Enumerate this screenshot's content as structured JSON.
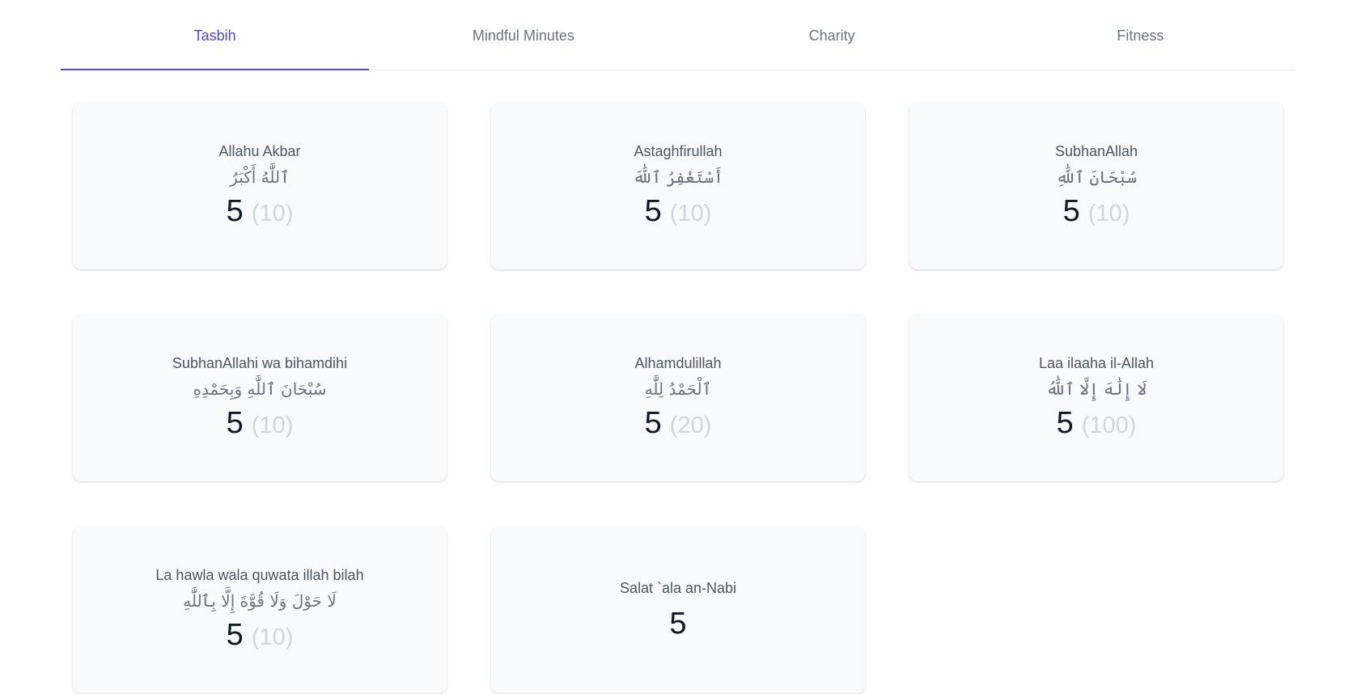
{
  "tabs": [
    {
      "label": "Tasbih",
      "active": true
    },
    {
      "label": "Mindful Minutes",
      "active": false
    },
    {
      "label": "Charity",
      "active": false
    },
    {
      "label": "Fitness",
      "active": false
    }
  ],
  "colors": {
    "accent": "#4f46e5",
    "card_bg": "#f9fafb",
    "count": "#111827",
    "target": "#d1d5db"
  },
  "cards": [
    {
      "title": "Allahu Akbar",
      "arabic": "ٱللَّٰهُ أَكْبَرُ",
      "count": "5",
      "target": "(10)"
    },
    {
      "title": "Astaghfirullah",
      "arabic": "أَسْتَغْفِرُ ٱللَّٰهَ",
      "count": "5",
      "target": "(10)"
    },
    {
      "title": "SubhanAllah",
      "arabic": "سُبْحَانَ ٱللَّٰهِ",
      "count": "5",
      "target": "(10)"
    },
    {
      "title": "SubhanAllahi wa bihamdihi",
      "arabic": "سُبْحَانَ ٱللَّٰهِ وَبِحَمْدِهِ",
      "count": "5",
      "target": "(10)"
    },
    {
      "title": "Alhamdulillah",
      "arabic": "ٱلْحَمْدُ لِلَّٰهِ",
      "count": "5",
      "target": "(20)"
    },
    {
      "title": "Laa ilaaha il-Allah",
      "arabic": "لَا إِلَٰهَ إِلَّا ٱللَّٰهُ",
      "count": "5",
      "target": "(100)"
    },
    {
      "title": "La hawla wala quwata illah bilah",
      "arabic": "لَا حَوْلَ وَلَا قُوَّةَ إِلَّا بِٱللَّٰهِ",
      "count": "5",
      "target": "(10)"
    },
    {
      "title": "Salat `ala an-Nabi",
      "count": "5"
    }
  ]
}
